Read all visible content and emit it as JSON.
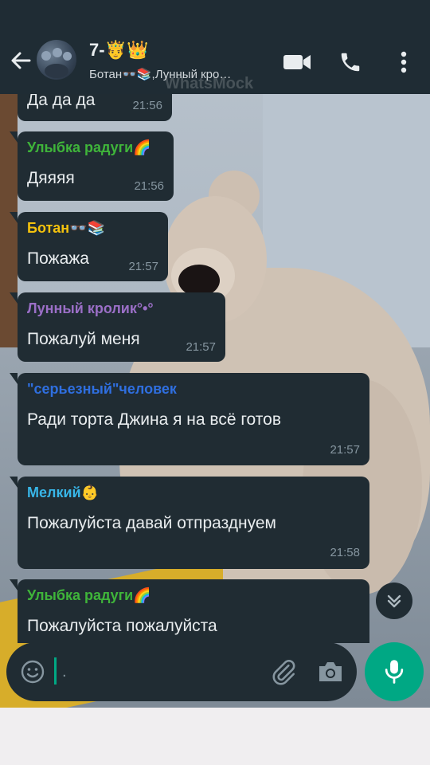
{
  "header": {
    "title": "7-🤴👑",
    "members": "Ботан👓📚,Лунный кро…",
    "watermark": "WhatsMock"
  },
  "icons": {
    "back": "arrow-left-icon",
    "video": "video-camera-icon",
    "call": "phone-icon",
    "menu": "more-vertical-icon",
    "emoji": "emoji-icon",
    "attach": "paperclip-icon",
    "camera": "camera-icon",
    "mic": "microphone-icon",
    "scroll": "chevron-down-double-icon"
  },
  "colors": {
    "header_bg": "#1f2c34",
    "bubble_bg": "#202c33",
    "accent": "#00a884"
  },
  "messages": [
    {
      "sender": "",
      "sender_color": "#e9edef",
      "text": "Да да да",
      "time": "21:56"
    },
    {
      "sender": "Улыбка радуги🌈",
      "sender_color": "#3fb53a",
      "text": "Дяяяя",
      "time": "21:56"
    },
    {
      "sender": "Ботан👓📚",
      "sender_color": "#f4c20d",
      "text": "Пожажа",
      "time": "21:57"
    },
    {
      "sender": "Лунный кролик°•°",
      "sender_color": "#9b6fc7",
      "text": "Пожалуй меня",
      "time": "21:57"
    },
    {
      "sender": "\"серьезный\"человек",
      "sender_color": "#2f6fe0",
      "text": "Ради торта Джина я на всё готов",
      "time": "21:57"
    },
    {
      "sender": "Мелкий👶",
      "sender_color": "#38b6e8",
      "text": "Пожалуйста давай отпразднуем",
      "time": "21:58"
    },
    {
      "sender": "Улыбка радуги🌈",
      "sender_color": "#3fb53a",
      "text": "Пожалуйста пожалуйста",
      "time": ""
    }
  ],
  "input": {
    "value": "."
  }
}
